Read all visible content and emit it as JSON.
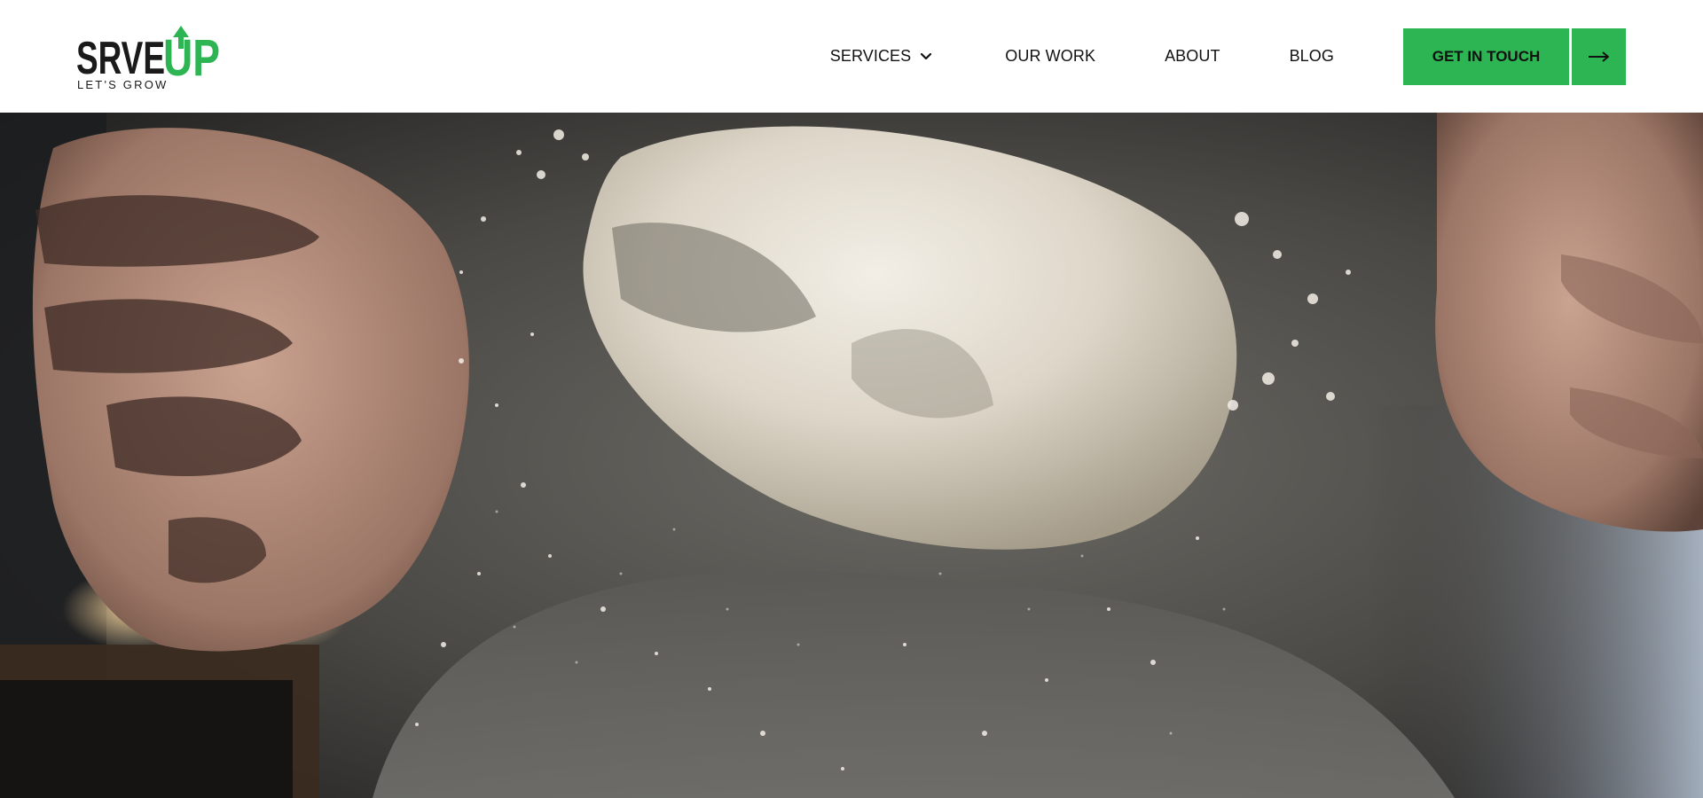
{
  "brand": {
    "wordmark_dark": "SRVE",
    "wordmark_green": "UP",
    "tagline": "LET'S GROW",
    "colors": {
      "green": "#2db553",
      "dark": "#1a1a1a"
    }
  },
  "nav": {
    "items": [
      {
        "label": "SERVICES",
        "has_dropdown": true,
        "icon": "chevron-down-icon"
      },
      {
        "label": "OUR WORK"
      },
      {
        "label": "ABOUT"
      },
      {
        "label": "BLOG"
      }
    ],
    "cta": {
      "label": "GET IN TOUCH",
      "icon": "arrow-right-icon"
    }
  },
  "hero": {
    "media": "video-frame-hands-tossing-flour-dough"
  }
}
